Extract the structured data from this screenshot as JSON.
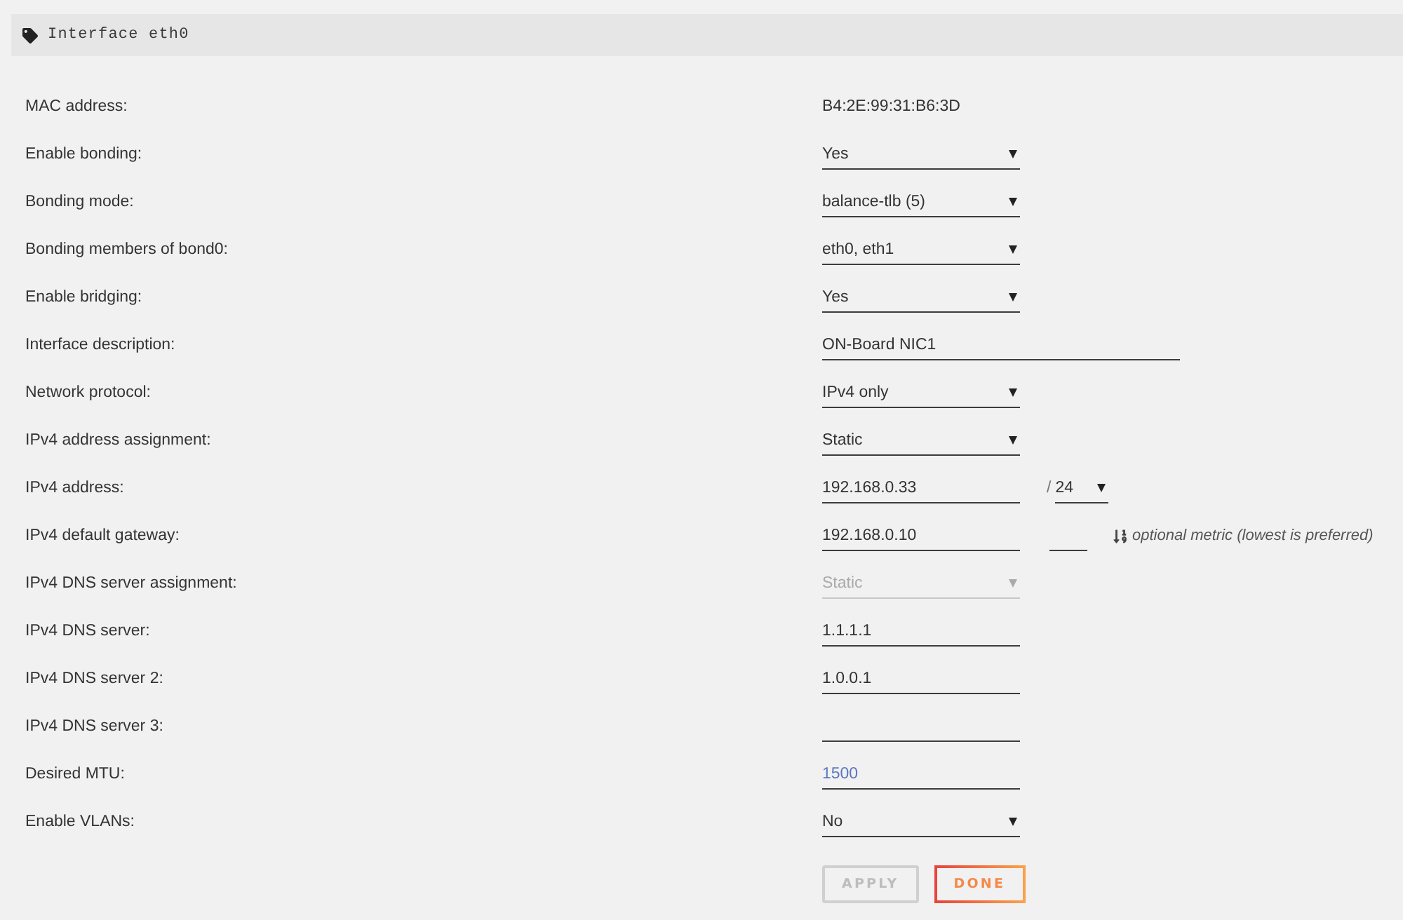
{
  "panel": {
    "title": "Interface eth0"
  },
  "fields": [
    {
      "kind": "text",
      "label": "MAC address:",
      "value": "B4:2E:99:31:B6:3D",
      "disabled": false
    },
    {
      "kind": "select",
      "label": "Enable bonding:",
      "value": "Yes",
      "disabled": false
    },
    {
      "kind": "select",
      "label": "Bonding mode:",
      "value": "balance-tlb (5)",
      "disabled": false
    },
    {
      "kind": "select",
      "label": "Bonding members of bond0:",
      "value": "eth0, eth1",
      "disabled": false
    },
    {
      "kind": "select",
      "label": "Enable bridging:",
      "value": "Yes",
      "disabled": false
    },
    {
      "kind": "long-input",
      "label": "Interface description:",
      "value": "ON-Board NIC1",
      "disabled": false
    },
    {
      "kind": "select",
      "label": "Network protocol:",
      "value": "IPv4 only",
      "disabled": false
    },
    {
      "kind": "select",
      "label": "IPv4 address assignment:",
      "value": "Static",
      "disabled": false
    },
    {
      "kind": "address",
      "label": "IPv4 address:",
      "value": "192.168.0.33",
      "separator": "/",
      "prefix": "24",
      "disabled": false
    },
    {
      "kind": "gateway",
      "label": "IPv4 default gateway:",
      "value": "192.168.0.10",
      "note": "optional metric (lowest is preferred)",
      "disabled": false
    },
    {
      "kind": "select",
      "label": "IPv4 DNS server assignment:",
      "value": "Static",
      "disabled": true
    },
    {
      "kind": "input",
      "label": "IPv4 DNS server:",
      "value": "1.1.1.1",
      "disabled": false
    },
    {
      "kind": "input",
      "label": "IPv4 DNS server 2:",
      "value": "1.0.0.1",
      "disabled": false
    },
    {
      "kind": "input",
      "label": "IPv4 DNS server 3:",
      "disabled": false
    },
    {
      "kind": "input",
      "label": "Desired MTU:",
      "placeholder": "1500",
      "disabled": false
    },
    {
      "kind": "select",
      "label": "Enable VLANs:",
      "value": "No",
      "disabled": false
    }
  ],
  "buttons": [
    {
      "label": "APPLY",
      "disabled": true
    },
    {
      "label": "DONE",
      "disabled": false
    }
  ]
}
